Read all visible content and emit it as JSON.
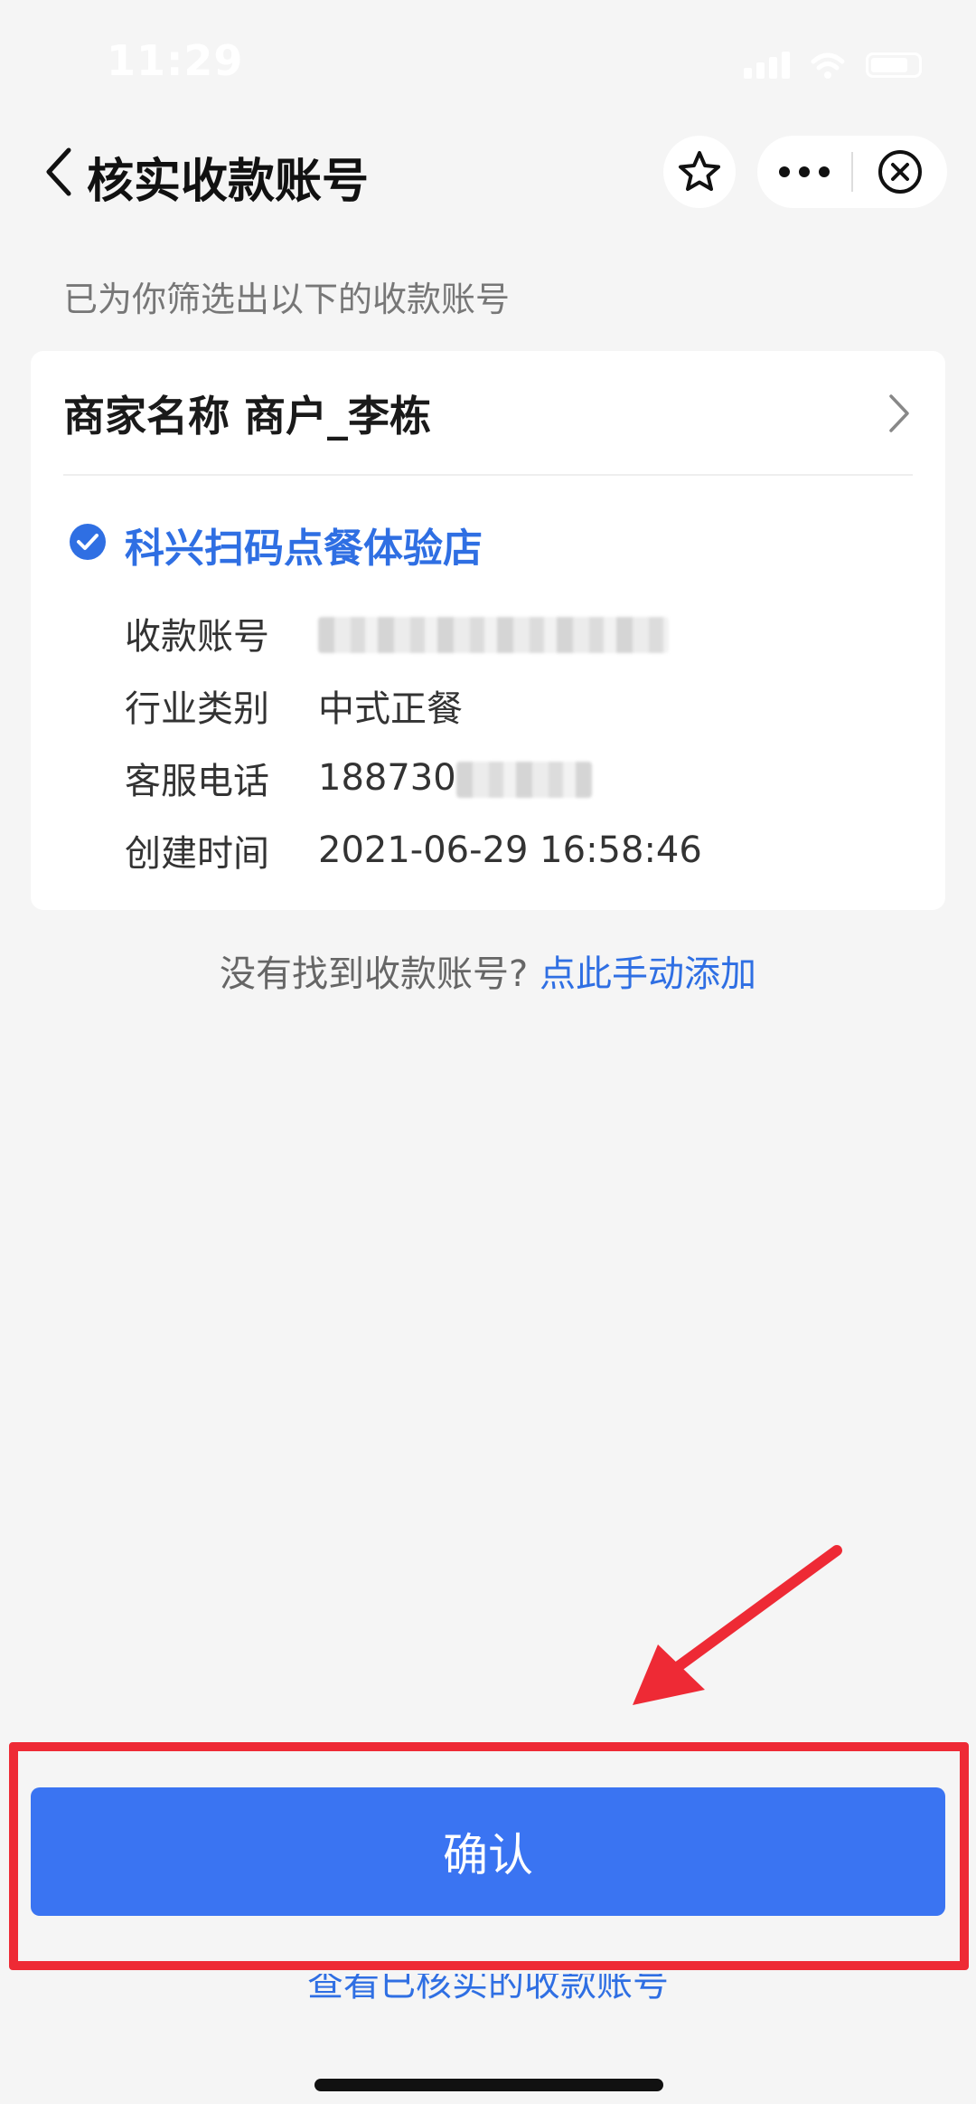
{
  "status_bar": {
    "time": "11:29"
  },
  "nav": {
    "title": "核实收款账号"
  },
  "subtitle": "已为你筛选出以下的收款账号",
  "merchant": {
    "label": "商家名称 商户_李栋"
  },
  "store": {
    "name": "科兴扫码点餐体验店",
    "checked": true,
    "rows": [
      {
        "label": "收款账号",
        "value": "",
        "value_blurred": true
      },
      {
        "label": "行业类别",
        "value": "中式正餐"
      },
      {
        "label": "客服电话",
        "value": "188730",
        "value_blurred": true
      },
      {
        "label": "创建时间",
        "value": "2021-06-29 16:58:46"
      }
    ]
  },
  "no_account": {
    "question": "没有找到收款账号?",
    "link": "点此手动添加"
  },
  "confirm_button": {
    "label": "确认"
  },
  "view_verified_link": "查看已核实的收款账号",
  "colors": {
    "accent": "#3a74f2",
    "link": "#2f6fe3",
    "annotation_red": "#ee2a35",
    "background": "#f5f5f5"
  },
  "icons": [
    "back-arrow-icon",
    "star-icon",
    "more-icon",
    "close-circle-icon",
    "chevron-right-icon",
    "check-circle-icon"
  ]
}
